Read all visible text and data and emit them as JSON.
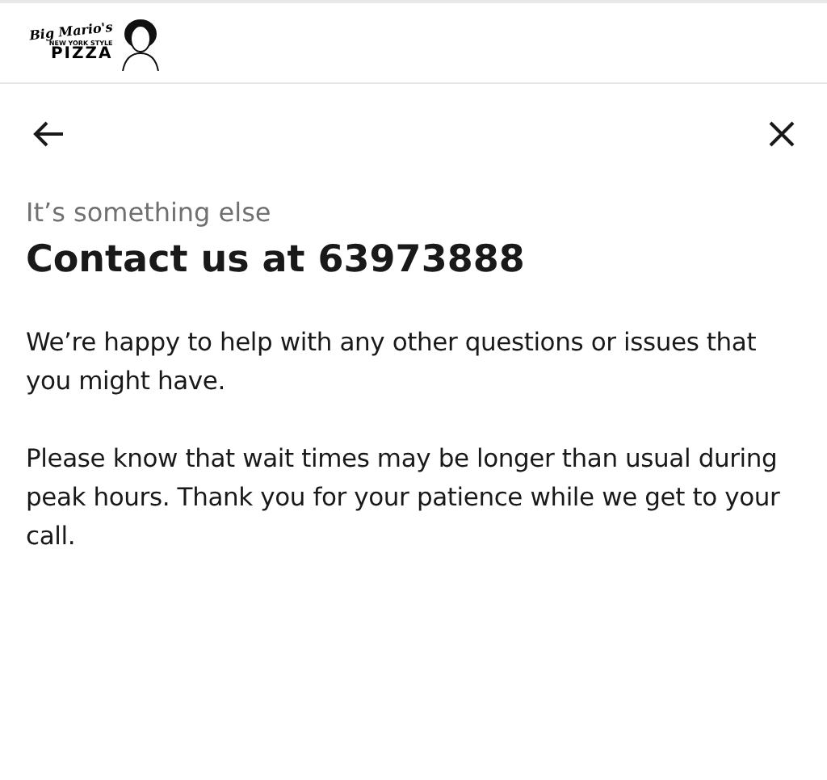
{
  "logo": {
    "script": "Big Mario's",
    "tagline": "NEW YORK STYLE",
    "name": "PIZZA"
  },
  "subtitle": "It’s something else",
  "title": "Contact us at 63973888",
  "paragraphs": [
    "We’re happy to help with any other questions or issues that you might have.",
    "Please know that wait times may be longer than usual during peak hours. Thank you for your patience while we get to your call."
  ]
}
